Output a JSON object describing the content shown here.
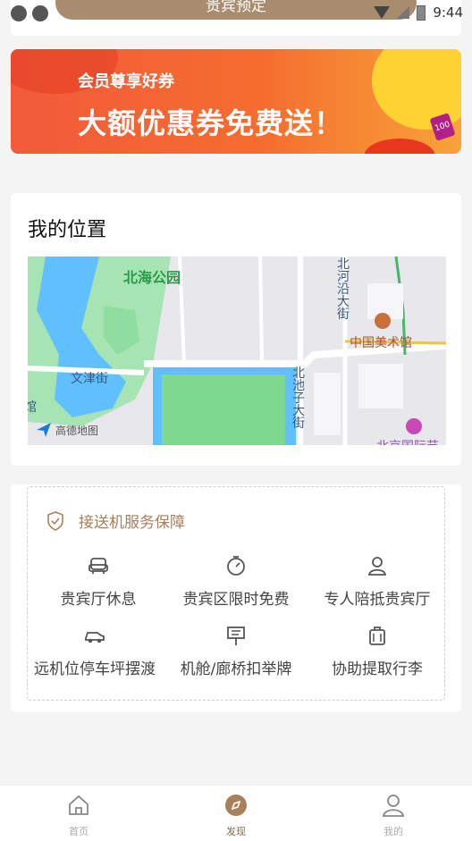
{
  "status_bar": {
    "time": "9:44"
  },
  "reserve_button": "贵宾预定",
  "banner": {
    "subtitle": "会员尊享好券",
    "title": "大额优惠券免费送！",
    "tag": "100"
  },
  "location": {
    "title": "我的位置",
    "map_labels": {
      "park": "北海公园",
      "street1": "文津街",
      "street2": "北河沿大街",
      "street3": "北池子大街",
      "museum": "中国美术馆",
      "edge_left": "馆",
      "provider": "高德地图",
      "poi_partial": "北京国际节"
    }
  },
  "service": {
    "title": "接送机服务保障",
    "items": [
      {
        "label": "贵宾厅休息",
        "icon": "sofa-icon"
      },
      {
        "label": "贵宾区限时免费",
        "icon": "stopwatch-icon"
      },
      {
        "label": "专人陪抵贵宾厅",
        "icon": "person-icon"
      },
      {
        "label": "远机位停车坪摆渡",
        "icon": "car-icon"
      },
      {
        "label": "机舱/廊桥扣举牌",
        "icon": "sign-icon"
      },
      {
        "label": "协助提取行李",
        "icon": "luggage-icon"
      }
    ]
  },
  "tabbar": {
    "tabs": [
      {
        "label": "首页",
        "icon": "home-icon"
      },
      {
        "label": "发现",
        "icon": "compass-icon"
      },
      {
        "label": "我的",
        "icon": "user-icon"
      }
    ]
  },
  "colors": {
    "accent": "#a8805a",
    "banner_orange": "#f5652e",
    "map_water": "#5fbfff",
    "map_park": "#8fdda0"
  }
}
